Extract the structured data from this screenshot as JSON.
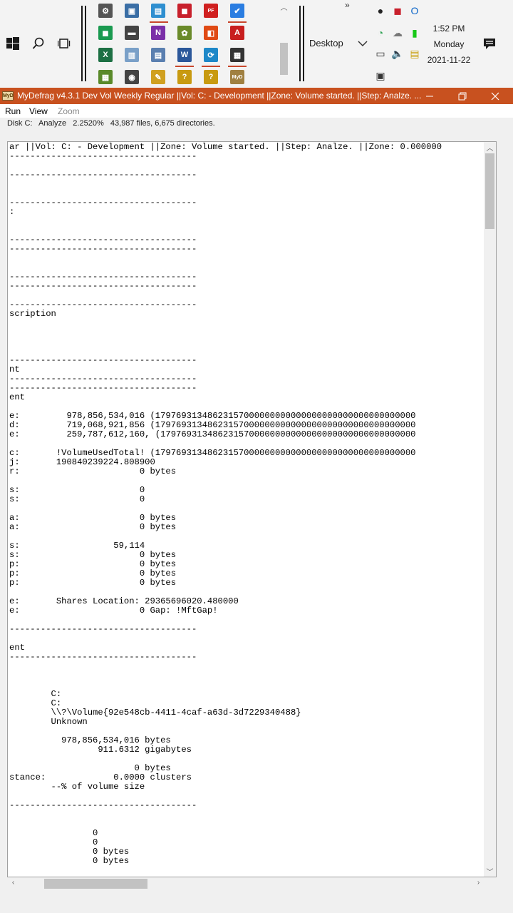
{
  "taskbar": {
    "toolbar_name": "Desktop",
    "toolbar_more": "»",
    "clock": {
      "time": "1:52 PM",
      "day": "Monday",
      "date": "2021-11-22"
    },
    "quick_launch_icons": [
      {
        "name": "settings-icon",
        "color": "#555555",
        "glyph": "⚙"
      },
      {
        "name": "network-computer-icon",
        "color": "#3a6ea5",
        "glyph": "▣"
      },
      {
        "name": "control-panel-icon",
        "color": "#2f8fd0",
        "glyph": "▤"
      },
      {
        "name": "red-app-icon",
        "color": "#c8202c",
        "glyph": "◼"
      },
      {
        "name": "pdf-printer-icon",
        "color": "#d02020",
        "glyph": "PF"
      },
      {
        "name": "todo-icon",
        "color": "#2a7de1",
        "glyph": "✔"
      },
      {
        "name": "green-app-icon",
        "color": "#1a9a50",
        "glyph": "◼"
      },
      {
        "name": "disk-icon",
        "color": "#444444",
        "glyph": "▬"
      },
      {
        "name": "onenote-icon",
        "color": "#7b2fa8",
        "glyph": "N"
      },
      {
        "name": "palm-tree-icon",
        "color": "#6a8a2a",
        "glyph": "✿"
      },
      {
        "name": "office-icon",
        "color": "#e04a14",
        "glyph": "◧"
      },
      {
        "name": "acrobat-icon",
        "color": "#c81e1e",
        "glyph": "A"
      },
      {
        "name": "excel-icon",
        "color": "#1d7044",
        "glyph": "X"
      },
      {
        "name": "notepad-icon",
        "color": "#7aa0c8",
        "glyph": "▥"
      },
      {
        "name": "document-icon",
        "color": "#5a7fb0",
        "glyph": "▤"
      },
      {
        "name": "word-icon",
        "color": "#2b579a",
        "glyph": "W"
      },
      {
        "name": "sync-icon",
        "color": "#1e88c8",
        "glyph": "⟳"
      },
      {
        "name": "film-icon",
        "color": "#333333",
        "glyph": "▦"
      },
      {
        "name": "spreadsheet-icon",
        "color": "#5a8a2a",
        "glyph": "▦"
      },
      {
        "name": "camera-icon",
        "color": "#444444",
        "glyph": "◉"
      },
      {
        "name": "paint-icon",
        "color": "#d0a020",
        "glyph": "✎"
      },
      {
        "name": "help-icon",
        "color": "#c89a10",
        "glyph": "?"
      },
      {
        "name": "help-file-icon",
        "color": "#c89a10",
        "glyph": "?"
      },
      {
        "name": "mydefrag-icon",
        "color": "#a08040",
        "glyph": "MyD"
      }
    ],
    "tray_icons": [
      {
        "name": "os-badge-icon",
        "color": "#222222",
        "glyph": "●"
      },
      {
        "name": "red-tray-icon",
        "color": "#c8202c",
        "glyph": "◼"
      },
      {
        "name": "outlook-icon",
        "color": "#0a64c8",
        "glyph": "O"
      },
      {
        "name": "alarm-icon",
        "color": "#2aa050",
        "glyph": "◔"
      },
      {
        "name": "onedrive-icon",
        "color": "#777777",
        "glyph": "☁"
      },
      {
        "name": "battery-icon",
        "color": "#18c818",
        "glyph": "▮"
      },
      {
        "name": "network-icon",
        "color": "#333333",
        "glyph": "▭"
      },
      {
        "name": "volume-icon",
        "color": "#333333",
        "glyph": "🔈"
      },
      {
        "name": "clipboard-icon",
        "color": "#c8a010",
        "glyph": "▤"
      },
      {
        "name": "printer-icon",
        "color": "#333333",
        "glyph": "▣"
      }
    ]
  },
  "window": {
    "app_icon": "MyD",
    "title": "MyDefrag v4.3.1   Dev Vol Weekly Regular ||Vol: C: - Development ||Zone: Volume started. ||Step: Analze. ...",
    "menu": [
      "Run",
      "View",
      "Zoom"
    ],
    "status": "Disk C:   Analyze   2.2520%   43,987 files, 6,675 directories."
  },
  "log_lines": [
    "ar ||Vol: C: - Development ||Zone: Volume started. ||Step: Analze. ||Zone: 0.000000",
    "------------------------------------",
    "",
    "------------------------------------",
    "",
    "",
    "------------------------------------",
    ":",
    "",
    "",
    "------------------------------------",
    "------------------------------------",
    "",
    "",
    "------------------------------------",
    "------------------------------------",
    "",
    "------------------------------------",
    "scription",
    "",
    "",
    "",
    "",
    "------------------------------------",
    "nt",
    "------------------------------------",
    "------------------------------------",
    "ent",
    "",
    "e:         978,856,534,016 (17976931348623157000000000000000000000000000000000",
    "d:         719,068,921,856 (17976931348623157000000000000000000000000000000000",
    "e:         259,787,612,160, (1797693134862315700000000000000000000000000000000",
    "",
    "c:       !VolumeUsedTotal! (17976931348623157000000000000000000000000000000000",
    "j:       190840239224.808900",
    "r:                       0 bytes",
    "",
    "s:                       0",
    "s:                       0",
    "",
    "a:                       0 bytes",
    "a:                       0 bytes",
    "",
    "s:                  59,114",
    "s:                       0 bytes",
    "p:                       0 bytes",
    "p:                       0 bytes",
    "p:                       0 bytes",
    "",
    "e:       Shares Location: 29365696020.480000",
    "e:                       0 Gap: !MftGap!",
    "",
    "------------------------------------",
    "",
    "ent",
    "------------------------------------",
    "",
    "",
    "",
    "        C:",
    "        C:",
    "        \\\\?\\Volume{92e548cb-4411-4caf-a63d-3d7229340488}",
    "        Unknown",
    "",
    "          978,856,534,016 bytes",
    "                 911.6312 gigabytes",
    "",
    "                        0 bytes",
    "stance:             0.0000 clusters",
    "        --% of volume size",
    "",
    "------------------------------------",
    "",
    "",
    "                0",
    "                0",
    "                0 bytes",
    "                0 bytes"
  ]
}
